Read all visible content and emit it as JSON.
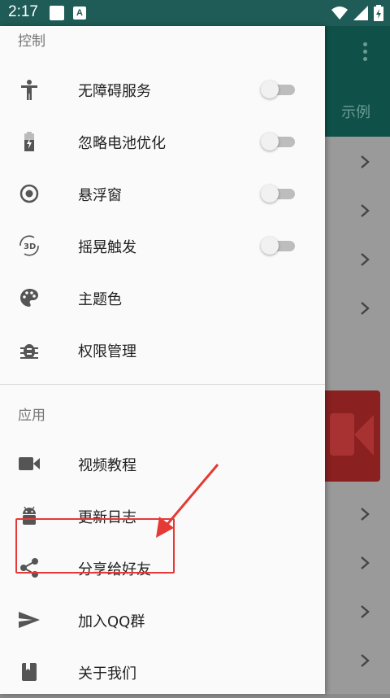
{
  "status_bar": {
    "time": "2:17",
    "notif_letter": "A"
  },
  "background_app": {
    "example_label": "示例"
  },
  "drawer": {
    "sections": [
      {
        "title": "控制"
      },
      {
        "title": "应用"
      }
    ],
    "control_items": [
      {
        "label": "无障碍服务",
        "icon": "accessibility-icon",
        "toggle": false
      },
      {
        "label": "忽略电池优化",
        "icon": "battery-icon",
        "toggle": false
      },
      {
        "label": "悬浮窗",
        "icon": "radio-target-icon",
        "toggle": false
      },
      {
        "label": "摇晃触发",
        "icon": "3d-rotation-icon",
        "toggle": false
      },
      {
        "label": "主题色",
        "icon": "palette-icon"
      },
      {
        "label": "权限管理",
        "icon": "bug-icon"
      }
    ],
    "app_items": [
      {
        "label": "视频教程",
        "icon": "video-camera-icon"
      },
      {
        "label": "更新日志",
        "icon": "android-icon"
      },
      {
        "label": "分享给好友",
        "icon": "share-icon"
      },
      {
        "label": "加入QQ群",
        "icon": "send-icon"
      },
      {
        "label": "关于我们",
        "icon": "book-icon"
      }
    ]
  },
  "colors": {
    "statusbar": "#1f5c57",
    "highlight": "#e53935",
    "icon": "#555555"
  }
}
